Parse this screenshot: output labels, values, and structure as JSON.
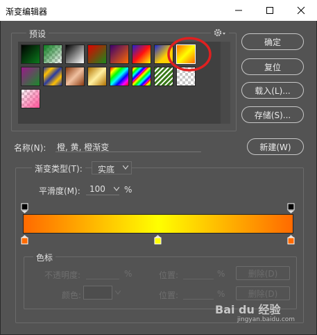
{
  "window": {
    "title": "渐变编辑器"
  },
  "presets": {
    "legend": "预设"
  },
  "buttons": {
    "ok": "确定",
    "reset": "复位",
    "load": "载入(L)...",
    "save": "存储(S)...",
    "new": "新建(W)"
  },
  "name": {
    "label": "名称(N):",
    "value": "橙, 黄, 橙渐变"
  },
  "gradient_type": {
    "legend": "渐变类型(T):",
    "value": "实底"
  },
  "smoothness": {
    "label": "平滑度(M):",
    "value": "100",
    "unit": "%"
  },
  "gradient": {
    "colors": [
      "#ff6a00",
      "#ffff00",
      "#ff6a00"
    ]
  },
  "color_stops": {
    "legend": "色标",
    "opacity_label": "不透明度:",
    "opacity_unit": "%",
    "location_label_1": "位置:",
    "location_unit_1": "%",
    "delete_1": "删除(D)",
    "color_label": "颜色:",
    "location_label_2": "位置:",
    "location_unit_2": "%",
    "delete_2": "删除(D)"
  },
  "watermark": {
    "brand": "Bai du 经验",
    "url": "jingyan.baidu.com"
  },
  "colors": {
    "highlight_circle": "#e02020",
    "accent": "#ff6a00"
  }
}
